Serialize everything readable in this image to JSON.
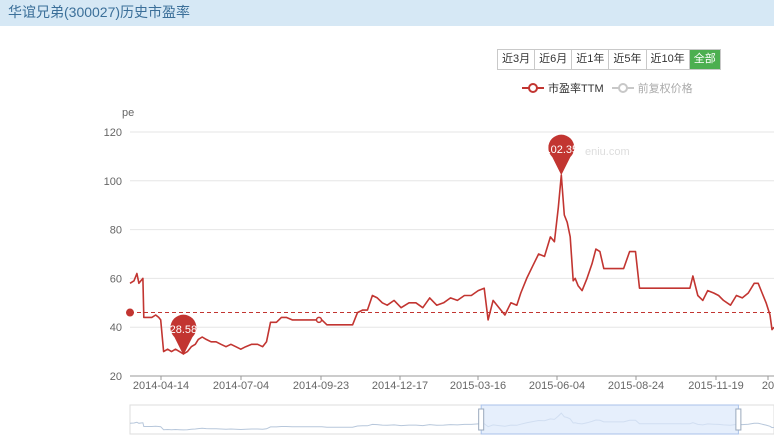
{
  "header": {
    "title": "华谊兄弟(300027)历史市盈率"
  },
  "range_buttons": [
    "近3月",
    "近6月",
    "近1年",
    "近5年",
    "近10年",
    "全部"
  ],
  "range_active_index": 5,
  "colors": {
    "series_main": "#c23531",
    "series_secondary": "#c8c8c8",
    "active_button": "#4caf50",
    "grid": "#e6e6e6",
    "axis_text": "#666666",
    "selection": "#dce8fb"
  },
  "chart_data": {
    "type": "line",
    "ylabel": "pe",
    "ylim": [
      20,
      120
    ],
    "yticks": [
      20,
      40,
      60,
      80,
      100,
      120
    ],
    "xlim": [
      "2014-03-25",
      "2016-01-05"
    ],
    "xticks": [
      "2014-04-14",
      "2014-07-04",
      "2014-09-23",
      "2014-12-17",
      "2015-03-16",
      "2015-06-04",
      "2015-08-24",
      "2015-11-19",
      "20"
    ],
    "grid": "horizontal",
    "legend_position": "top-right",
    "series": [
      {
        "name": "市盈率TTM",
        "color": "#c23531",
        "active": true,
        "points": [
          [
            "2014-03-25",
            58
          ],
          [
            "2014-03-29",
            59
          ],
          [
            "2014-04-01",
            62
          ],
          [
            "2014-04-03",
            58
          ],
          [
            "2014-04-05",
            59
          ],
          [
            "2014-04-07",
            60
          ],
          [
            "2014-04-08",
            44
          ],
          [
            "2014-04-16",
            44
          ],
          [
            "2014-04-20",
            45
          ],
          [
            "2014-04-23",
            44
          ],
          [
            "2014-04-25",
            43
          ],
          [
            "2014-04-28",
            30
          ],
          [
            "2014-05-02",
            31
          ],
          [
            "2014-05-06",
            30
          ],
          [
            "2014-05-10",
            31
          ],
          [
            "2014-05-14",
            30
          ],
          [
            "2014-05-18",
            29
          ],
          [
            "2014-05-22",
            30
          ],
          [
            "2014-05-26",
            32
          ],
          [
            "2014-05-30",
            33
          ],
          [
            "2014-06-02",
            35
          ],
          [
            "2014-06-06",
            36
          ],
          [
            "2014-06-10",
            35
          ],
          [
            "2014-06-15",
            34
          ],
          [
            "2014-06-20",
            34
          ],
          [
            "2014-06-25",
            33
          ],
          [
            "2014-06-30",
            32
          ],
          [
            "2014-07-05",
            33
          ],
          [
            "2014-07-10",
            32
          ],
          [
            "2014-07-15",
            31
          ],
          [
            "2014-07-20",
            32
          ],
          [
            "2014-07-26",
            33
          ],
          [
            "2014-08-01",
            33
          ],
          [
            "2014-08-06",
            32
          ],
          [
            "2014-08-10",
            34
          ],
          [
            "2014-08-14",
            42
          ],
          [
            "2014-08-20",
            42
          ],
          [
            "2014-08-25",
            44
          ],
          [
            "2014-08-30",
            44
          ],
          [
            "2014-09-05",
            43
          ],
          [
            "2014-09-12",
            43
          ],
          [
            "2014-09-20",
            43
          ],
          [
            "2014-09-28",
            43
          ],
          [
            "2014-10-05",
            43
          ],
          [
            "2014-10-10",
            41
          ],
          [
            "2014-10-20",
            41
          ],
          [
            "2014-10-30",
            41
          ],
          [
            "2014-11-05",
            41
          ],
          [
            "2014-11-10",
            46
          ],
          [
            "2014-11-15",
            47
          ],
          [
            "2014-11-20",
            47
          ],
          [
            "2014-11-25",
            53
          ],
          [
            "2014-11-30",
            52
          ],
          [
            "2014-12-05",
            50
          ],
          [
            "2014-12-10",
            49
          ],
          [
            "2014-12-17",
            51
          ],
          [
            "2014-12-24",
            48
          ],
          [
            "2015-01-01",
            50
          ],
          [
            "2015-01-08",
            50
          ],
          [
            "2015-01-15",
            48
          ],
          [
            "2015-01-22",
            52
          ],
          [
            "2015-01-29",
            49
          ],
          [
            "2015-02-05",
            50
          ],
          [
            "2015-02-12",
            52
          ],
          [
            "2015-02-19",
            51
          ],
          [
            "2015-02-26",
            53
          ],
          [
            "2015-03-05",
            53
          ],
          [
            "2015-03-12",
            55
          ],
          [
            "2015-03-18",
            56
          ],
          [
            "2015-03-22",
            43
          ],
          [
            "2015-03-27",
            51
          ],
          [
            "2015-04-02",
            48
          ],
          [
            "2015-04-08",
            45
          ],
          [
            "2015-04-14",
            50
          ],
          [
            "2015-04-20",
            49
          ],
          [
            "2015-04-24",
            54
          ],
          [
            "2015-04-30",
            60
          ],
          [
            "2015-05-06",
            65
          ],
          [
            "2015-05-12",
            70
          ],
          [
            "2015-05-18",
            69
          ],
          [
            "2015-05-24",
            77
          ],
          [
            "2015-05-28",
            75
          ],
          [
            "2015-06-01",
            89
          ],
          [
            "2015-06-04",
            102.35
          ],
          [
            "2015-06-07",
            86
          ],
          [
            "2015-06-10",
            83
          ],
          [
            "2015-06-13",
            77
          ],
          [
            "2015-06-16",
            59
          ],
          [
            "2015-06-18",
            60
          ],
          [
            "2015-06-21",
            57
          ],
          [
            "2015-06-25",
            55
          ],
          [
            "2015-06-30",
            60
          ],
          [
            "2015-07-05",
            66
          ],
          [
            "2015-07-09",
            72
          ],
          [
            "2015-07-13",
            71
          ],
          [
            "2015-07-17",
            64
          ],
          [
            "2015-07-27",
            64
          ],
          [
            "2015-08-06",
            64
          ],
          [
            "2015-08-12",
            71
          ],
          [
            "2015-08-18",
            71
          ],
          [
            "2015-08-22",
            56
          ],
          [
            "2015-09-10",
            56
          ],
          [
            "2015-09-30",
            56
          ],
          [
            "2015-10-12",
            56
          ],
          [
            "2015-10-15",
            61
          ],
          [
            "2015-10-20",
            53
          ],
          [
            "2015-10-25",
            51
          ],
          [
            "2015-10-30",
            55
          ],
          [
            "2015-11-05",
            54
          ],
          [
            "2015-11-10",
            53
          ],
          [
            "2015-11-15",
            51
          ],
          [
            "2015-11-22",
            49
          ],
          [
            "2015-11-28",
            53
          ],
          [
            "2015-12-04",
            52
          ],
          [
            "2015-12-10",
            54
          ],
          [
            "2015-12-16",
            58
          ],
          [
            "2015-12-20",
            58
          ],
          [
            "2015-12-24",
            54
          ],
          [
            "2015-12-28",
            50
          ],
          [
            "2016-01-01",
            45
          ],
          [
            "2016-01-03",
            39
          ],
          [
            "2016-01-05",
            40
          ]
        ]
      },
      {
        "name": "前复权价格",
        "color": "#c8c8c8",
        "active": false,
        "points": []
      }
    ],
    "reference_line": {
      "value": 46,
      "style": "dashed"
    },
    "annotations": [
      {
        "label": "28.58",
        "x": "2014-05-18",
        "y": 28.58,
        "type": "min"
      },
      {
        "label": "102.35",
        "x": "2015-06-04",
        "y": 102.35,
        "type": "max"
      }
    ],
    "navigator": {
      "start": "2015-03-15",
      "end": "2015-11-30"
    }
  }
}
